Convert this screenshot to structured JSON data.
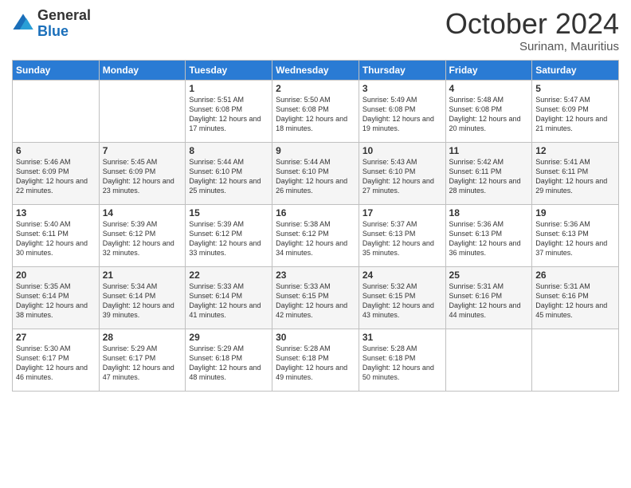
{
  "logo": {
    "general": "General",
    "blue": "Blue"
  },
  "title": "October 2024",
  "subtitle": "Surinam, Mauritius",
  "days": [
    "Sunday",
    "Monday",
    "Tuesday",
    "Wednesday",
    "Thursday",
    "Friday",
    "Saturday"
  ],
  "weeks": [
    [
      {
        "day": "",
        "content": ""
      },
      {
        "day": "",
        "content": ""
      },
      {
        "day": "1",
        "content": "Sunrise: 5:51 AM\nSunset: 6:08 PM\nDaylight: 12 hours and 17 minutes."
      },
      {
        "day": "2",
        "content": "Sunrise: 5:50 AM\nSunset: 6:08 PM\nDaylight: 12 hours and 18 minutes."
      },
      {
        "day": "3",
        "content": "Sunrise: 5:49 AM\nSunset: 6:08 PM\nDaylight: 12 hours and 19 minutes."
      },
      {
        "day": "4",
        "content": "Sunrise: 5:48 AM\nSunset: 6:08 PM\nDaylight: 12 hours and 20 minutes."
      },
      {
        "day": "5",
        "content": "Sunrise: 5:47 AM\nSunset: 6:09 PM\nDaylight: 12 hours and 21 minutes."
      }
    ],
    [
      {
        "day": "6",
        "content": "Sunrise: 5:46 AM\nSunset: 6:09 PM\nDaylight: 12 hours and 22 minutes."
      },
      {
        "day": "7",
        "content": "Sunrise: 5:45 AM\nSunset: 6:09 PM\nDaylight: 12 hours and 23 minutes."
      },
      {
        "day": "8",
        "content": "Sunrise: 5:44 AM\nSunset: 6:10 PM\nDaylight: 12 hours and 25 minutes."
      },
      {
        "day": "9",
        "content": "Sunrise: 5:44 AM\nSunset: 6:10 PM\nDaylight: 12 hours and 26 minutes."
      },
      {
        "day": "10",
        "content": "Sunrise: 5:43 AM\nSunset: 6:10 PM\nDaylight: 12 hours and 27 minutes."
      },
      {
        "day": "11",
        "content": "Sunrise: 5:42 AM\nSunset: 6:11 PM\nDaylight: 12 hours and 28 minutes."
      },
      {
        "day": "12",
        "content": "Sunrise: 5:41 AM\nSunset: 6:11 PM\nDaylight: 12 hours and 29 minutes."
      }
    ],
    [
      {
        "day": "13",
        "content": "Sunrise: 5:40 AM\nSunset: 6:11 PM\nDaylight: 12 hours and 30 minutes."
      },
      {
        "day": "14",
        "content": "Sunrise: 5:39 AM\nSunset: 6:12 PM\nDaylight: 12 hours and 32 minutes."
      },
      {
        "day": "15",
        "content": "Sunrise: 5:39 AM\nSunset: 6:12 PM\nDaylight: 12 hours and 33 minutes."
      },
      {
        "day": "16",
        "content": "Sunrise: 5:38 AM\nSunset: 6:12 PM\nDaylight: 12 hours and 34 minutes."
      },
      {
        "day": "17",
        "content": "Sunrise: 5:37 AM\nSunset: 6:13 PM\nDaylight: 12 hours and 35 minutes."
      },
      {
        "day": "18",
        "content": "Sunrise: 5:36 AM\nSunset: 6:13 PM\nDaylight: 12 hours and 36 minutes."
      },
      {
        "day": "19",
        "content": "Sunrise: 5:36 AM\nSunset: 6:13 PM\nDaylight: 12 hours and 37 minutes."
      }
    ],
    [
      {
        "day": "20",
        "content": "Sunrise: 5:35 AM\nSunset: 6:14 PM\nDaylight: 12 hours and 38 minutes."
      },
      {
        "day": "21",
        "content": "Sunrise: 5:34 AM\nSunset: 6:14 PM\nDaylight: 12 hours and 39 minutes."
      },
      {
        "day": "22",
        "content": "Sunrise: 5:33 AM\nSunset: 6:14 PM\nDaylight: 12 hours and 41 minutes."
      },
      {
        "day": "23",
        "content": "Sunrise: 5:33 AM\nSunset: 6:15 PM\nDaylight: 12 hours and 42 minutes."
      },
      {
        "day": "24",
        "content": "Sunrise: 5:32 AM\nSunset: 6:15 PM\nDaylight: 12 hours and 43 minutes."
      },
      {
        "day": "25",
        "content": "Sunrise: 5:31 AM\nSunset: 6:16 PM\nDaylight: 12 hours and 44 minutes."
      },
      {
        "day": "26",
        "content": "Sunrise: 5:31 AM\nSunset: 6:16 PM\nDaylight: 12 hours and 45 minutes."
      }
    ],
    [
      {
        "day": "27",
        "content": "Sunrise: 5:30 AM\nSunset: 6:17 PM\nDaylight: 12 hours and 46 minutes."
      },
      {
        "day": "28",
        "content": "Sunrise: 5:29 AM\nSunset: 6:17 PM\nDaylight: 12 hours and 47 minutes."
      },
      {
        "day": "29",
        "content": "Sunrise: 5:29 AM\nSunset: 6:18 PM\nDaylight: 12 hours and 48 minutes."
      },
      {
        "day": "30",
        "content": "Sunrise: 5:28 AM\nSunset: 6:18 PM\nDaylight: 12 hours and 49 minutes."
      },
      {
        "day": "31",
        "content": "Sunrise: 5:28 AM\nSunset: 6:18 PM\nDaylight: 12 hours and 50 minutes."
      },
      {
        "day": "",
        "content": ""
      },
      {
        "day": "",
        "content": ""
      }
    ]
  ]
}
